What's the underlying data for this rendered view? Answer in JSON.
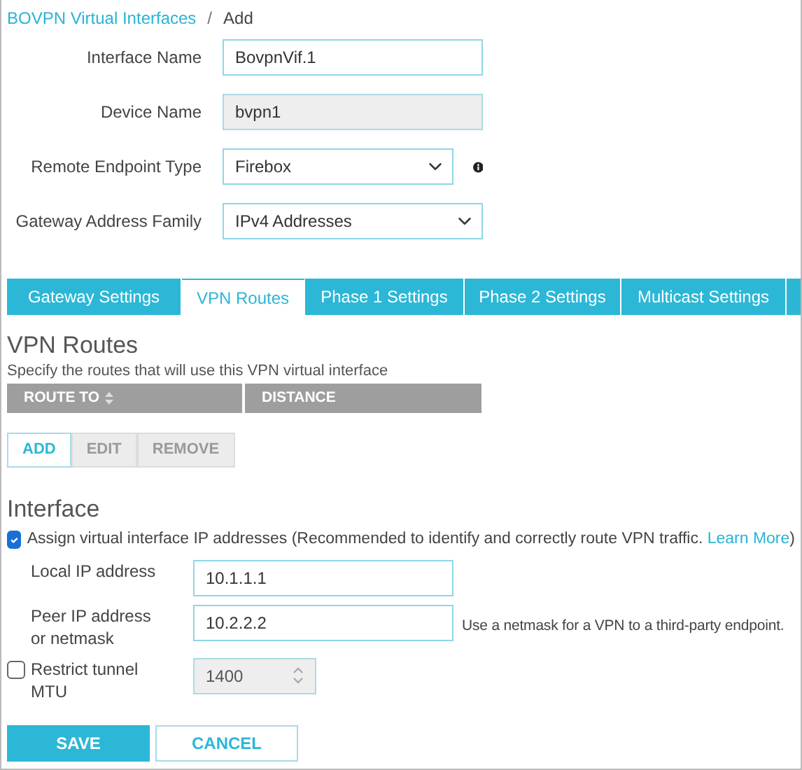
{
  "breadcrumb": {
    "parent": "BOVPN Virtual Interfaces",
    "separator": "/",
    "current": "Add"
  },
  "form_fields": [
    {
      "label": "Interface Name",
      "kind": "text",
      "value": "BovpnVif.1",
      "disabled": false,
      "info": false
    },
    {
      "label": "Device Name",
      "kind": "text",
      "value": "bvpn1",
      "disabled": true,
      "info": false
    },
    {
      "label": "Remote Endpoint Type",
      "kind": "select",
      "value": "Firebox",
      "disabled": false,
      "info": true
    },
    {
      "label": "Gateway Address Family",
      "kind": "select",
      "value": "IPv4 Addresses",
      "disabled": false,
      "info": false
    }
  ],
  "tabs": [
    {
      "label": "Gateway Settings",
      "selected": false
    },
    {
      "label": "VPN Routes",
      "selected": true
    },
    {
      "label": "Phase 1 Settings",
      "selected": false
    },
    {
      "label": "Phase 2 Settings",
      "selected": false
    },
    {
      "label": "Multicast Settings",
      "selected": false
    }
  ],
  "routes": {
    "title": "VPN Routes",
    "description": "Specify the routes that will use this VPN virtual interface",
    "columns": [
      {
        "label": "ROUTE TO",
        "sortable": true
      },
      {
        "label": "DISTANCE",
        "sortable": false
      }
    ],
    "buttons": [
      {
        "label": "ADD",
        "disabled": false
      },
      {
        "label": "EDIT",
        "disabled": true
      },
      {
        "label": "REMOVE",
        "disabled": true
      }
    ]
  },
  "interface": {
    "title": "Interface",
    "assign": {
      "checked": true,
      "text": "Assign virtual interface IP addresses (Recommended to identify and correctly route VPN traffic.",
      "link": "Learn More",
      "text_after": ")"
    },
    "fields": [
      {
        "label": "Local IP address",
        "value": "10.1.1.1"
      },
      {
        "label": "Peer IP address or netmask",
        "value": "10.2.2.2",
        "note": "Use a netmask for a VPN to a third-party endpoint."
      }
    ],
    "mtu": {
      "checked": false,
      "label": "Restrict tunnel MTU",
      "value": "1400",
      "disabled": true
    }
  },
  "actions": [
    {
      "label": "SAVE",
      "kind": "primary"
    },
    {
      "label": "CANCEL",
      "kind": "secondary"
    }
  ]
}
